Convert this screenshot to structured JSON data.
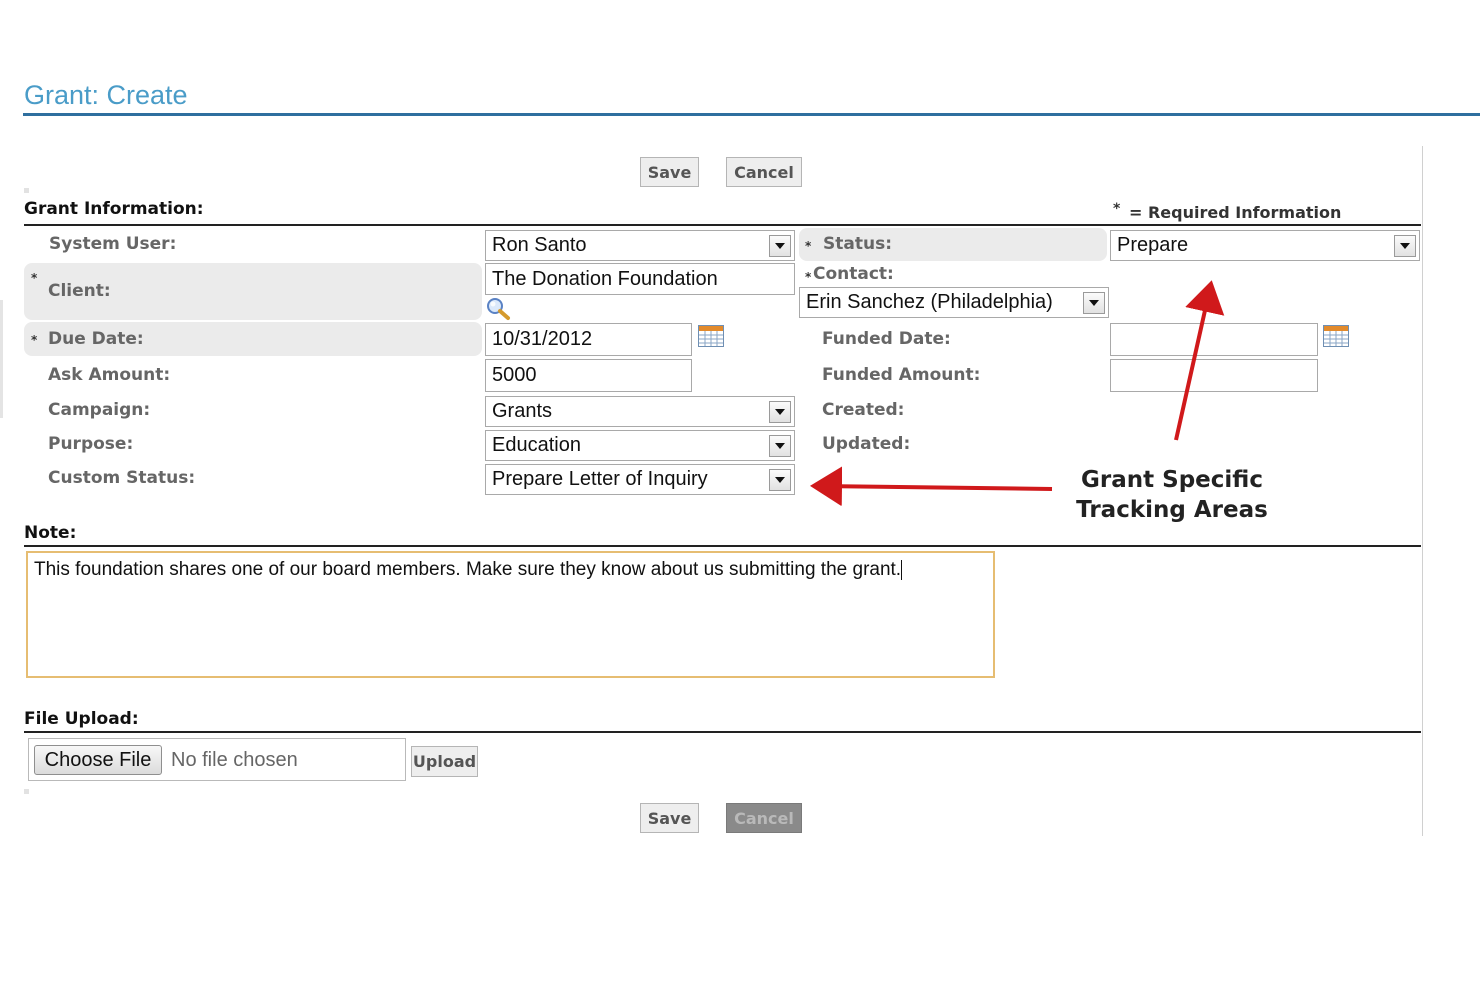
{
  "page": {
    "title": "Grant: Create"
  },
  "toolbar": {
    "save_label": "Save",
    "cancel_label": "Cancel"
  },
  "required_note": {
    "star": "*",
    "text": "= Required Information"
  },
  "sections": {
    "grant_info": "Grant Information:",
    "note": "Note:",
    "file_upload": "File Upload:"
  },
  "fields": {
    "system_user": {
      "label": "System User:",
      "value": "Ron Santo"
    },
    "status": {
      "label": "Status:",
      "value": "Prepare"
    },
    "client": {
      "label": "Client:",
      "value": "The Donation Foundation"
    },
    "contact": {
      "label": "Contact:",
      "value": "Erin Sanchez (Philadelphia)"
    },
    "due_date": {
      "label": "Due Date:",
      "value": "10/31/2012"
    },
    "funded_date": {
      "label": "Funded Date:",
      "value": ""
    },
    "ask_amount": {
      "label": "Ask Amount:",
      "value": "5000"
    },
    "funded_amount": {
      "label": "Funded Amount:",
      "value": ""
    },
    "campaign": {
      "label": "Campaign:",
      "value": "Grants"
    },
    "created": {
      "label": "Created:"
    },
    "purpose": {
      "label": "Purpose:",
      "value": "Education"
    },
    "updated": {
      "label": "Updated:"
    },
    "custom_status": {
      "label": "Custom Status:",
      "value": "Prepare Letter of Inquiry"
    }
  },
  "note": {
    "text": "This foundation shares one of our board members.  Make sure they know about us submitting the grant."
  },
  "file_upload": {
    "choose_label": "Choose File",
    "status": "No file chosen",
    "upload_label": "Upload"
  },
  "annotation": {
    "line1": "Grant Specific",
    "line2": "Tracking Areas"
  },
  "colors": {
    "title": "#4a9cc8",
    "title_rule": "#2f6f9f",
    "arrow": "#d0191b",
    "note_border": "#e6bd72"
  },
  "icons": {
    "lookup": "magnifier-icon",
    "calendar": "calendar-icon",
    "dropdown": "chevron-down-icon"
  }
}
